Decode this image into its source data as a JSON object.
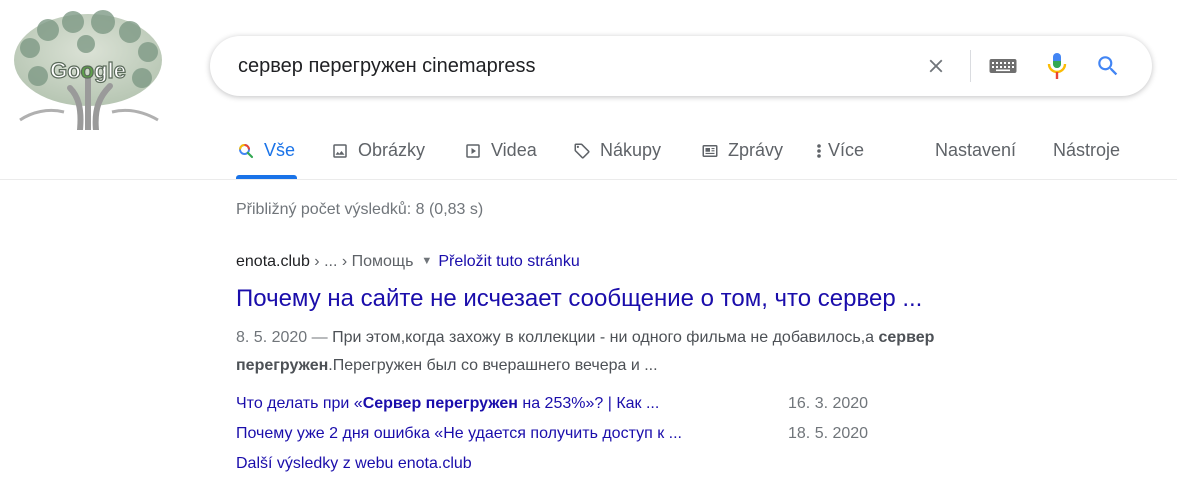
{
  "logo": {
    "text": "Google"
  },
  "search": {
    "query": "сервер перегружен cinemapress"
  },
  "tabs": [
    {
      "label": "Vše",
      "icon": "search-icon"
    },
    {
      "label": "Obrázky",
      "icon": "image-icon"
    },
    {
      "label": "Videa",
      "icon": "play-icon"
    },
    {
      "label": "Nákupy",
      "icon": "tag-icon"
    },
    {
      "label": "Zprávy",
      "icon": "news-icon"
    },
    {
      "label": "Více",
      "icon": "more-vert-icon"
    }
  ],
  "tools": {
    "settings": "Nastavení",
    "tools": "Nástroje"
  },
  "stats": "Přibližný počet výsledků: 8 (0,83 s)",
  "result": {
    "domain": "enota.club",
    "crumb": " › ... › Помощь",
    "translate": "Přeložit tuto stránku",
    "title": "Почему на сайте не исчезает сообщение о том, что сервер ...",
    "date": "8. 5. 2020 — ",
    "snippet_1": "При этом,когда захожу в коллекции - ни одного фильма не добавилось,а ",
    "snippet_bold": "сервер перегружен",
    "snippet_2": ".Перегружен был со вчерашнего вечера и ...",
    "sublinks": [
      {
        "pre": "Что делать при «",
        "bold": "Сервер перегружен",
        "post": " на 253%»? | Как ...",
        "date": "16. 3. 2020"
      },
      {
        "pre": "Почему уже 2 дня ошибка «Не удается получить доступ к ...",
        "bold": "",
        "post": "",
        "date": "18. 5. 2020"
      }
    ],
    "more": "Další výsledky z webu enota.club"
  },
  "colors": {
    "link": "#1a0dab",
    "accent": "#1a73e8",
    "muted": "#70757a"
  }
}
